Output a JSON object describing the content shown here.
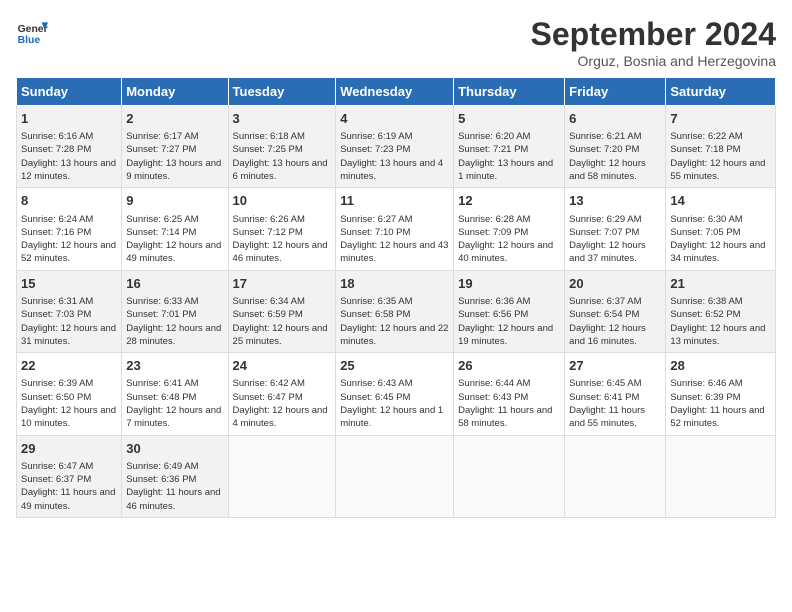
{
  "logo": {
    "line1": "General",
    "line2": "Blue"
  },
  "title": "September 2024",
  "subtitle": "Orguz, Bosnia and Herzegovina",
  "days_of_week": [
    "Sunday",
    "Monday",
    "Tuesday",
    "Wednesday",
    "Thursday",
    "Friday",
    "Saturday"
  ],
  "weeks": [
    [
      {
        "day": "1",
        "info": "Sunrise: 6:16 AM\nSunset: 7:28 PM\nDaylight: 13 hours and 12 minutes."
      },
      {
        "day": "2",
        "info": "Sunrise: 6:17 AM\nSunset: 7:27 PM\nDaylight: 13 hours and 9 minutes."
      },
      {
        "day": "3",
        "info": "Sunrise: 6:18 AM\nSunset: 7:25 PM\nDaylight: 13 hours and 6 minutes."
      },
      {
        "day": "4",
        "info": "Sunrise: 6:19 AM\nSunset: 7:23 PM\nDaylight: 13 hours and 4 minutes."
      },
      {
        "day": "5",
        "info": "Sunrise: 6:20 AM\nSunset: 7:21 PM\nDaylight: 13 hours and 1 minute."
      },
      {
        "day": "6",
        "info": "Sunrise: 6:21 AM\nSunset: 7:20 PM\nDaylight: 12 hours and 58 minutes."
      },
      {
        "day": "7",
        "info": "Sunrise: 6:22 AM\nSunset: 7:18 PM\nDaylight: 12 hours and 55 minutes."
      }
    ],
    [
      {
        "day": "8",
        "info": "Sunrise: 6:24 AM\nSunset: 7:16 PM\nDaylight: 12 hours and 52 minutes."
      },
      {
        "day": "9",
        "info": "Sunrise: 6:25 AM\nSunset: 7:14 PM\nDaylight: 12 hours and 49 minutes."
      },
      {
        "day": "10",
        "info": "Sunrise: 6:26 AM\nSunset: 7:12 PM\nDaylight: 12 hours and 46 minutes."
      },
      {
        "day": "11",
        "info": "Sunrise: 6:27 AM\nSunset: 7:10 PM\nDaylight: 12 hours and 43 minutes."
      },
      {
        "day": "12",
        "info": "Sunrise: 6:28 AM\nSunset: 7:09 PM\nDaylight: 12 hours and 40 minutes."
      },
      {
        "day": "13",
        "info": "Sunrise: 6:29 AM\nSunset: 7:07 PM\nDaylight: 12 hours and 37 minutes."
      },
      {
        "day": "14",
        "info": "Sunrise: 6:30 AM\nSunset: 7:05 PM\nDaylight: 12 hours and 34 minutes."
      }
    ],
    [
      {
        "day": "15",
        "info": "Sunrise: 6:31 AM\nSunset: 7:03 PM\nDaylight: 12 hours and 31 minutes."
      },
      {
        "day": "16",
        "info": "Sunrise: 6:33 AM\nSunset: 7:01 PM\nDaylight: 12 hours and 28 minutes."
      },
      {
        "day": "17",
        "info": "Sunrise: 6:34 AM\nSunset: 6:59 PM\nDaylight: 12 hours and 25 minutes."
      },
      {
        "day": "18",
        "info": "Sunrise: 6:35 AM\nSunset: 6:58 PM\nDaylight: 12 hours and 22 minutes."
      },
      {
        "day": "19",
        "info": "Sunrise: 6:36 AM\nSunset: 6:56 PM\nDaylight: 12 hours and 19 minutes."
      },
      {
        "day": "20",
        "info": "Sunrise: 6:37 AM\nSunset: 6:54 PM\nDaylight: 12 hours and 16 minutes."
      },
      {
        "day": "21",
        "info": "Sunrise: 6:38 AM\nSunset: 6:52 PM\nDaylight: 12 hours and 13 minutes."
      }
    ],
    [
      {
        "day": "22",
        "info": "Sunrise: 6:39 AM\nSunset: 6:50 PM\nDaylight: 12 hours and 10 minutes."
      },
      {
        "day": "23",
        "info": "Sunrise: 6:41 AM\nSunset: 6:48 PM\nDaylight: 12 hours and 7 minutes."
      },
      {
        "day": "24",
        "info": "Sunrise: 6:42 AM\nSunset: 6:47 PM\nDaylight: 12 hours and 4 minutes."
      },
      {
        "day": "25",
        "info": "Sunrise: 6:43 AM\nSunset: 6:45 PM\nDaylight: 12 hours and 1 minute."
      },
      {
        "day": "26",
        "info": "Sunrise: 6:44 AM\nSunset: 6:43 PM\nDaylight: 11 hours and 58 minutes."
      },
      {
        "day": "27",
        "info": "Sunrise: 6:45 AM\nSunset: 6:41 PM\nDaylight: 11 hours and 55 minutes."
      },
      {
        "day": "28",
        "info": "Sunrise: 6:46 AM\nSunset: 6:39 PM\nDaylight: 11 hours and 52 minutes."
      }
    ],
    [
      {
        "day": "29",
        "info": "Sunrise: 6:47 AM\nSunset: 6:37 PM\nDaylight: 11 hours and 49 minutes."
      },
      {
        "day": "30",
        "info": "Sunrise: 6:49 AM\nSunset: 6:36 PM\nDaylight: 11 hours and 46 minutes."
      },
      null,
      null,
      null,
      null,
      null
    ]
  ]
}
